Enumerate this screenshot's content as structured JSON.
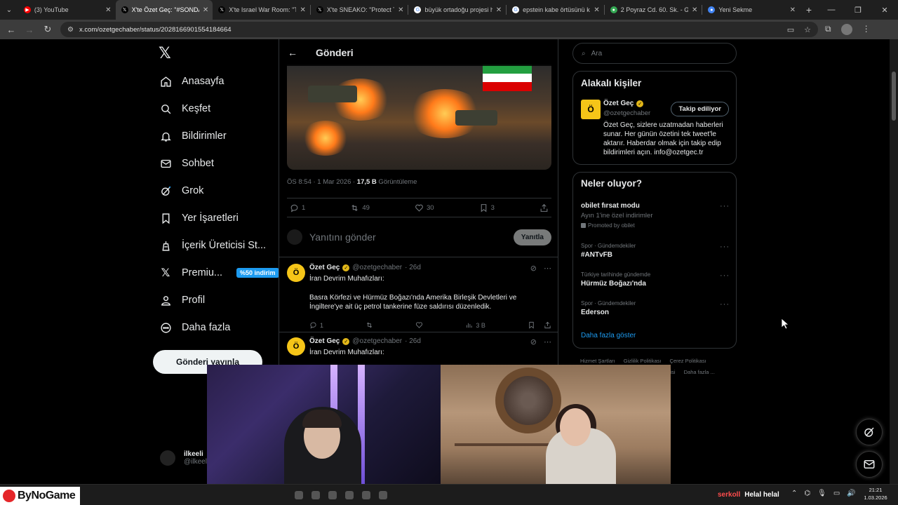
{
  "browser": {
    "tabs": [
      {
        "title": "(3) YouTube",
        "favicon_color": "#ff0000",
        "active": false
      },
      {
        "title": "X'te Özet Geç: \"#SONDAKİKA",
        "favicon_color": "#000000",
        "active": true
      },
      {
        "title": "X'te Israel War Room: \"Tu",
        "favicon_color": "#000000",
        "active": false
      },
      {
        "title": "X'te SNEAKO: \"Protect Tu",
        "favicon_color": "#000000",
        "active": false
      },
      {
        "title": "büyük ortadoğu projesi h",
        "favicon_color": "#4285f4",
        "active": false
      },
      {
        "title": "epstein kabe örtüsünü kı",
        "favicon_color": "#4285f4",
        "active": false
      },
      {
        "title": "2 Poyraz Cd. 60. Sk. - Goo",
        "favicon_color": "#34a853",
        "active": false
      },
      {
        "title": "Yeni Sekme",
        "favicon_color": "#4285f4",
        "active": false
      }
    ],
    "url": "x.com/ozetgechaber/status/2028166901554184664"
  },
  "leftnav": {
    "items": [
      {
        "label": "Anasayfa",
        "icon": "home-icon"
      },
      {
        "label": "Keşfet",
        "icon": "search-icon"
      },
      {
        "label": "Bildirimler",
        "icon": "bell-icon"
      },
      {
        "label": "Sohbet",
        "icon": "mail-icon"
      },
      {
        "label": "Grok",
        "icon": "grok-icon"
      },
      {
        "label": "Yer İşaretleri",
        "icon": "bookmark-icon"
      },
      {
        "label": "İçerik Üreticisi St...",
        "icon": "creator-icon"
      },
      {
        "label": "Premiu...",
        "icon": "x-premium-icon",
        "badge": "%50 indirim"
      },
      {
        "label": "Profil",
        "icon": "profile-icon"
      },
      {
        "label": "Daha fazla",
        "icon": "more-circle-icon"
      }
    ],
    "post_button": "Gönderi yayınla",
    "account": {
      "name": "ilkeeli",
      "handle": "@ilkeeli"
    }
  },
  "center": {
    "header_title": "Gönderi",
    "post_meta": {
      "time": "ÖS 8:54 · 1 Mar 2026 · ",
      "views": "17,5 B",
      "views_label": " Görüntüleme"
    },
    "post_actions": {
      "replies": "1",
      "reposts": "49",
      "likes": "30",
      "bookmarks": "3"
    },
    "reply_placeholder": "Yanıtını gönder",
    "reply_button": "Yanıtla",
    "replies": [
      {
        "name": "Özet Geç",
        "handle": "@ozetgechaber",
        "time": "· 26d",
        "lines": [
          "İran Devrim Muhafızları:",
          "Basra Körfezi ve Hürmüz Boğazı'nda Amerika Birleşik Devletleri ve İngiltere'ye ait üç petrol tankerine füze saldırısı düzenledik."
        ],
        "reply_count": "1",
        "views": "3 B"
      },
      {
        "name": "Özet Geç",
        "handle": "@ozetgechaber",
        "time": "· 26d",
        "lines": [
          "İran Devrim Muhafızları:"
        ]
      }
    ]
  },
  "right": {
    "search_placeholder": "Ara",
    "related_title": "Alakalı kişiler",
    "related": {
      "name": "Özet Geç",
      "handle": "@ozetgechaber",
      "follow_label": "Takip ediliyor",
      "bio": "Özet Geç, sizlere uzatmadan haberleri sunar. Her günün özetini tek tweet'le aktarır. Haberdar olmak için takip edip bildirimleri açın. info@ozetgec.tr"
    },
    "trends_title": "Neler oluyor?",
    "trends": [
      {
        "category": "",
        "name": "obilet fırsat modu",
        "sub": "Ayın 1'ine özel indirimler",
        "promo": "Promoted by obilet"
      },
      {
        "category": "Spor · Gündemdekiler",
        "name": "#ANTvFB",
        "sub": "",
        "promo": ""
      },
      {
        "category": "Türkiye tarihinde gündemde",
        "name": "Hürmüz Boğazı'nda",
        "sub": "",
        "promo": ""
      },
      {
        "category": "Spor · Gündemdekiler",
        "name": "Ederson",
        "sub": "",
        "promo": ""
      }
    ],
    "show_more": "Daha fazla göster",
    "footer_links": [
      "Hizmet Şartları",
      "Gizlilik Politikası",
      "Çerez Politikası",
      "...gisi",
      "Daha fazla ..."
    ]
  },
  "taskbar": {
    "brand": "ByNoGame",
    "chat_user": "serkoll",
    "chat_message": "Helal helal",
    "time": "21:21",
    "date": "1.03.2026"
  },
  "colors": {
    "accent": "#1d9bf0",
    "verified_gold": "#e2b719",
    "background": "#000000",
    "border": "#2f3336",
    "muted_text": "#71767b"
  }
}
